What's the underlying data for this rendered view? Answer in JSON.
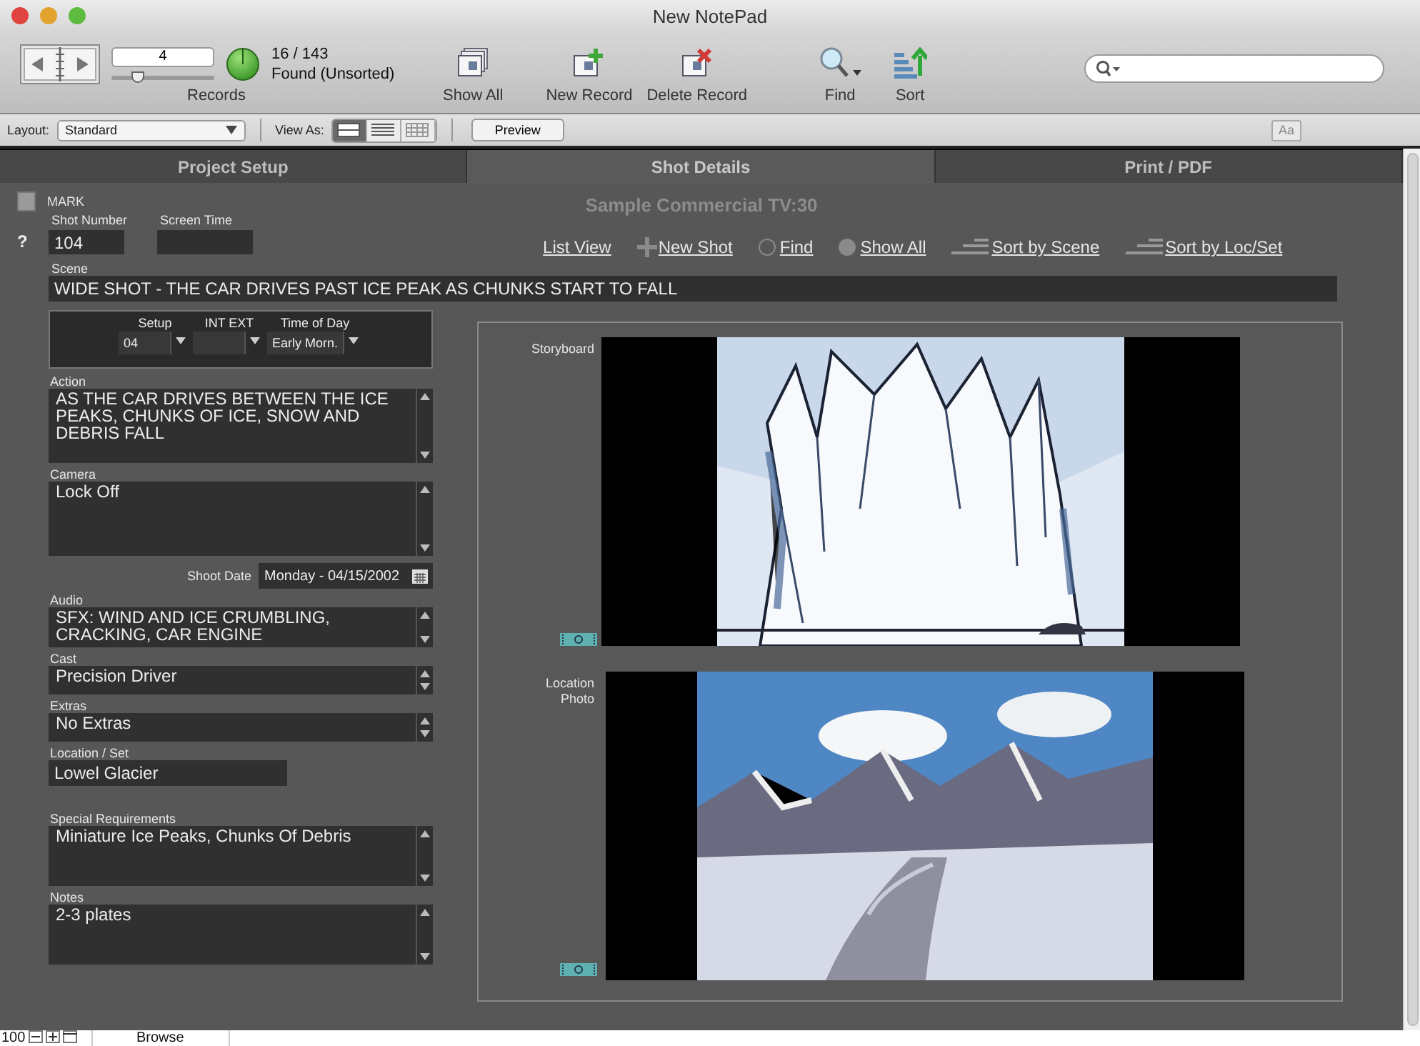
{
  "window": {
    "title": "New NotePad"
  },
  "toolbar": {
    "record_number": "4",
    "record_slider": {
      "level": 0.25
    },
    "found_count": "16 / 143",
    "found_status": "Found (Unsorted)",
    "records_label": "Records",
    "buttons": [
      {
        "label": "Show All",
        "kind": "show-all"
      },
      {
        "label": "New Record",
        "kind": "new-record"
      },
      {
        "label": "Delete Record",
        "kind": "delete-record"
      },
      {
        "label": "Find",
        "kind": "find"
      },
      {
        "label": "Sort",
        "kind": "sort"
      }
    ]
  },
  "layout_bar": {
    "layout_label": "Layout:",
    "layout_value": "Standard",
    "view_as_label": "View As:",
    "views": [
      {
        "kind": "form",
        "selected": true
      },
      {
        "kind": "list",
        "selected": false
      },
      {
        "kind": "table",
        "selected": false
      }
    ],
    "preview_button": "Preview",
    "text_button": "Aa"
  },
  "tabs": [
    {
      "label": "Project Setup",
      "selected": false
    },
    {
      "label": "Shot Details",
      "selected": true
    },
    {
      "label": "Print / PDF",
      "selected": false
    }
  ],
  "form": {
    "mark": {
      "label": "MARK",
      "checked": false
    },
    "help": "?",
    "title": "Sample Commercial TV:30",
    "shot_number": {
      "label": "Shot Number",
      "value": "104"
    },
    "screen_time": {
      "label": "Screen Time"
    },
    "actions": [
      {
        "label": "List View",
        "kind": "plain"
      },
      {
        "label": "New Shot",
        "kind": "add"
      },
      {
        "label": "Find",
        "kind": "radio",
        "selected": false
      },
      {
        "label": "Show All",
        "kind": "radio",
        "selected": true
      },
      {
        "label": "Sort by Scene",
        "kind": "sort"
      },
      {
        "label": "Sort by Loc/Set",
        "kind": "sort"
      }
    ],
    "scene": {
      "label": "Scene",
      "value": "WIDE SHOT - THE CAR DRIVES PAST ICE PEAK AS CHUNKS START TO FALL"
    },
    "setup": [
      {
        "label": "Setup",
        "value": "04"
      },
      {
        "label": "INT EXT"
      },
      {
        "label": "Time of Day",
        "value": "Early Morn."
      }
    ],
    "fields": [
      {
        "label": "Action",
        "value": "AS THE CAR DRIVES BETWEEN THE ICE PEAKS, CHUNKS OF ICE, SNOW AND DEBRIS FALL",
        "kind": "memo-large"
      },
      {
        "label": "Camera",
        "value": "Lock Off",
        "kind": "memo-large"
      },
      {
        "label": "Shoot Date",
        "value": "Monday - 04/15/2002",
        "kind": "date"
      },
      {
        "label": "Audio",
        "value": "SFX: WIND AND ICE CRUMBLING, CRACKING, CAR ENGINE",
        "kind": "memo-small"
      },
      {
        "label": "Cast",
        "value": "Precision Driver",
        "kind": "memo-line"
      },
      {
        "label": "Extras",
        "value": "No Extras",
        "kind": "memo-line"
      },
      {
        "label": "Location / Set",
        "value": "Lowel Glacier",
        "kind": "line"
      },
      {
        "label": "Special Requirements",
        "value": "Miniature Ice Peaks, Chunks Of Debris",
        "kind": "memo-medium"
      },
      {
        "label": "Notes",
        "value": "2-3 plates",
        "kind": "memo-medium"
      }
    ],
    "media": [
      {
        "label": "Storyboard",
        "kind": "sketch"
      },
      {
        "label": "Location Photo",
        "kind": "photo"
      }
    ]
  },
  "status_bar": {
    "zoom": "100",
    "mode": "Browse"
  }
}
